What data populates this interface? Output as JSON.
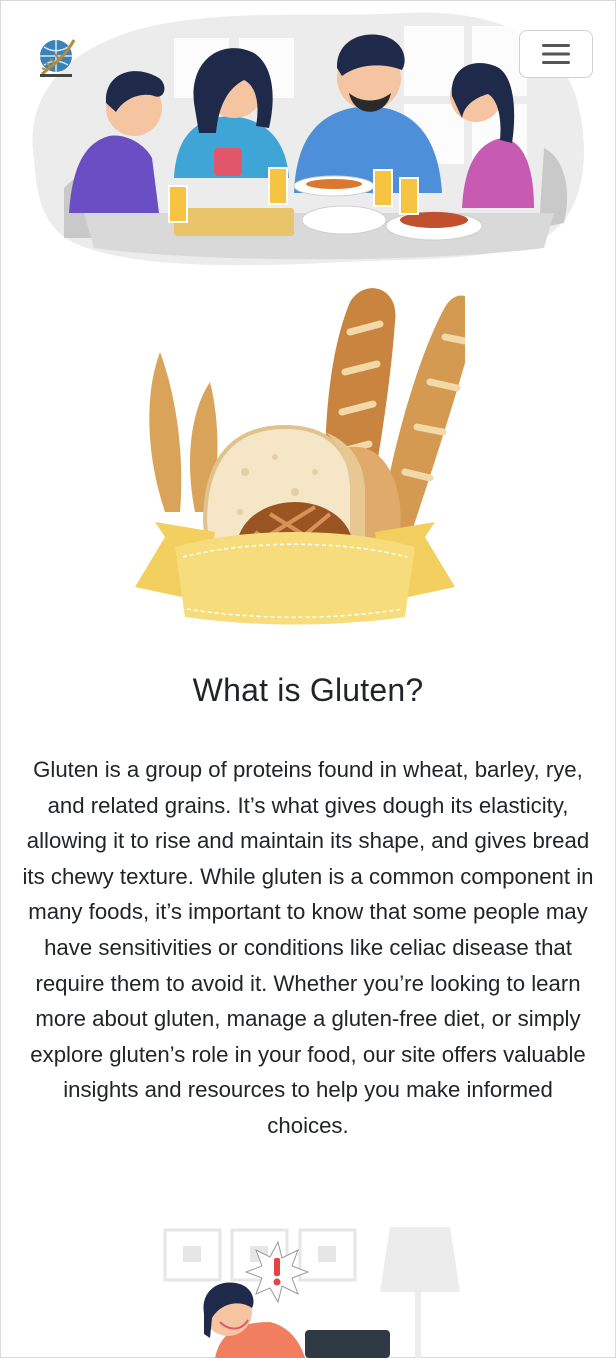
{
  "header": {
    "logo_icon": "globe-wheat-logo-icon",
    "menu_icon": "hamburger-menu-icon"
  },
  "hero": {
    "illustration": "family-dinner-illustration"
  },
  "section": {
    "illustration": "bread-and-wheat-illustration",
    "title": "What is Gluten?",
    "description": "Gluten is a group of proteins found in wheat, barley, rye, and related grains. It’s what gives dough its elasticity, allowing it to rise and maintain its shape, and gives bread its chewy texture. While gluten is a common component in many foods, it’s important to know that some people may have sensitivities or conditions like celiac disease that require them to avoid it. Whether you’re looking to learn more about gluten, manage a gluten-free diet, or simply explore gluten’s role in your food, our site offers valuable insights and resources to help you make informed choices."
  },
  "next_section": {
    "illustration": "stressed-woman-illustration",
    "alert_symbol": "!"
  },
  "colors": {
    "text": "#212529",
    "border": "#d0d0d0",
    "bread_crust": "#c9843f",
    "ribbon": "#f7dc7c",
    "alert": "#e4453f"
  }
}
